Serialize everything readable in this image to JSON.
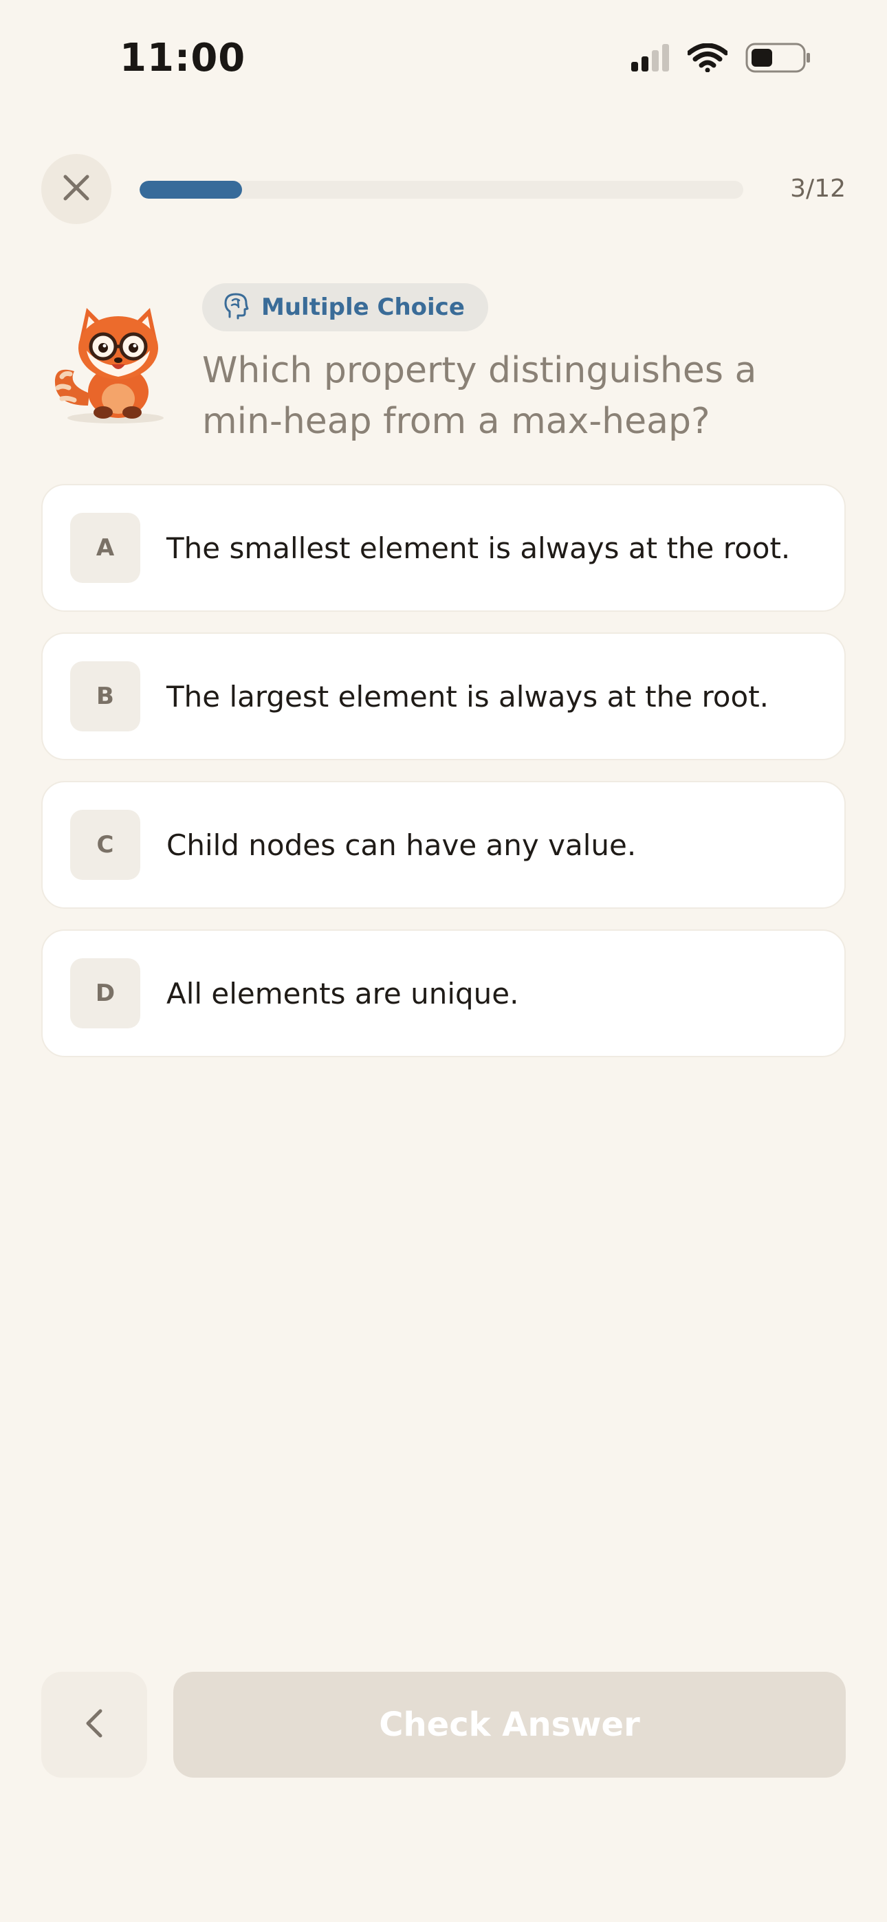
{
  "status_bar": {
    "time": "11:00",
    "icons": [
      "cellular-signal-icon",
      "wifi-icon",
      "battery-icon"
    ]
  },
  "header": {
    "close_icon": "close-icon",
    "progress_current": 3,
    "progress_total": 12,
    "progress_label": "3/12",
    "progress_fraction": 0.17,
    "progress_color": "#376b9a"
  },
  "question": {
    "type_icon": "brain-icon",
    "type_label": "Multiple Choice",
    "text": "Which property distinguishes a min-heap from a max-heap?"
  },
  "options": [
    {
      "letter": "A",
      "text": "The smallest element is always at the root."
    },
    {
      "letter": "B",
      "text": "The largest element is always at the root."
    },
    {
      "letter": "C",
      "text": "Child nodes can have any value."
    },
    {
      "letter": "D",
      "text": "All elements are unique."
    }
  ],
  "footer": {
    "back_icon": "chevron-left-icon",
    "check_label": "Check Answer"
  },
  "colors": {
    "background": "#f9f5ee",
    "accent": "#376b9a",
    "disabled_button": "#e4ddd3"
  }
}
